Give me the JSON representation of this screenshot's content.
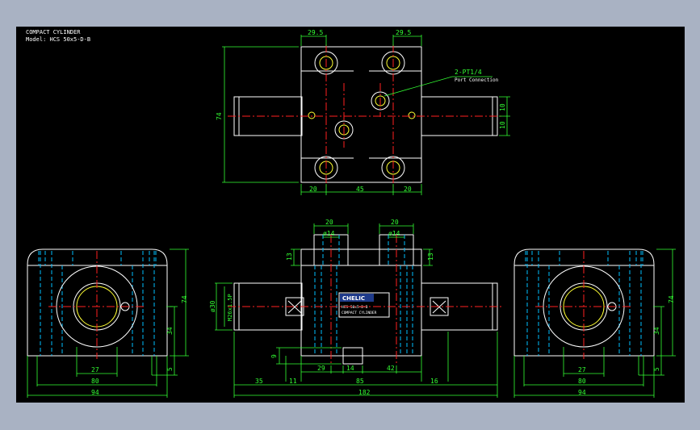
{
  "title": {
    "line1": "COMPACT CYLINDER",
    "line2": "Model: HCS 50x5-D-B"
  },
  "colors": {
    "background": "#000000",
    "frame": "#a9b2c3",
    "outline": "#ffffff",
    "hidden": "#00bfff",
    "center": "#ff2020",
    "dimension": "#33ff33",
    "detail": "#ffff33"
  },
  "callouts": {
    "port_spec": "2-PT1/4",
    "port_note": "Port Connection"
  },
  "plate": {
    "brand": "CHELIC",
    "model": "HCS 50x5-D-B",
    "name": "COMPACT CYLINDER"
  },
  "dimensions": {
    "top_29_5_left": "29.5",
    "top_29_5_right": "29.5",
    "top_74": "74",
    "top_10_a": "10",
    "top_10_b": "10",
    "top_20_left": "20",
    "top_45": "45",
    "top_20_right": "20",
    "front_20_left": "20",
    "front_20_right": "20",
    "front_d14_left": "ø14",
    "front_d14_right": "ø14",
    "front_13_left": "13",
    "front_13_right": "13",
    "front_d30": "ø30",
    "front_m26": "M26x1.5P",
    "front_9": "9",
    "front_29": "29",
    "front_14": "14",
    "front_42": "42",
    "front_35": "35",
    "front_11": "11",
    "front_85": "85",
    "front_16": "16",
    "front_182": "182",
    "left_74": "74",
    "left_34": "34",
    "left_5": "5",
    "left_27": "27",
    "left_80": "80",
    "left_94": "94",
    "right_74": "74",
    "right_34": "34",
    "right_5": "5",
    "right_27": "27",
    "right_80": "80",
    "right_94": "94"
  }
}
